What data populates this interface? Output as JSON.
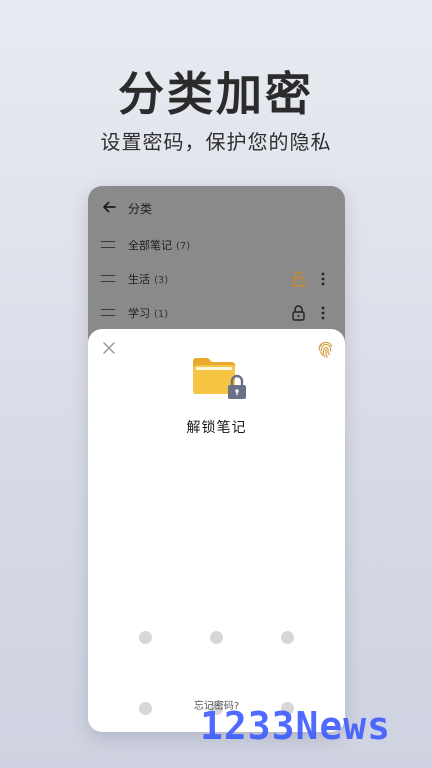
{
  "promo": {
    "headline": "分类加密",
    "subline": "设置密码，保护您的隐私"
  },
  "app": {
    "title": "分类",
    "categories": [
      {
        "label": "全部笔记",
        "count": "(7)",
        "lock": "none"
      },
      {
        "label": "生活",
        "count": "(3)",
        "lock": "unlocked-orange"
      },
      {
        "label": "学习",
        "count": "(1)",
        "lock": "locked"
      }
    ]
  },
  "unlock_sheet": {
    "title": "解锁笔记",
    "forgot_label": "忘记密码?",
    "icons": [
      "close-icon",
      "fingerprint-icon",
      "locked-folder-icon"
    ],
    "pattern_grid": {
      "rows": 3,
      "cols": 3
    }
  },
  "colors": {
    "accent_orange": "#c98a2a",
    "folder_yellow": "#f5c543",
    "lock_gray": "#6b7085",
    "watermark_blue": "#3d5cff"
  },
  "watermark": "1233News"
}
